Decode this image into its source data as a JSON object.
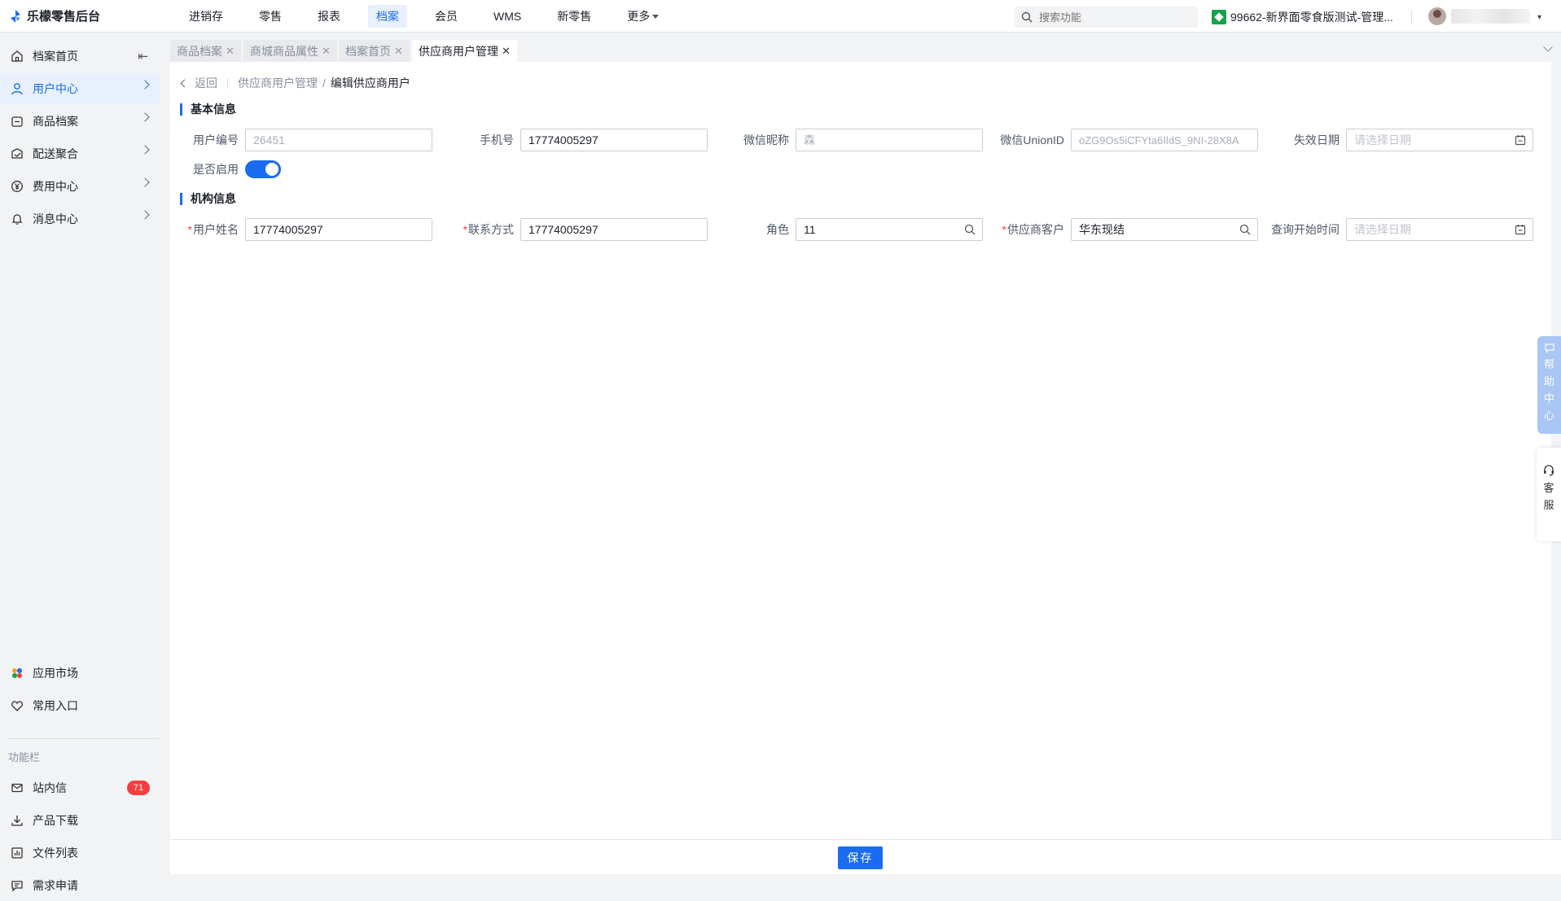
{
  "app": {
    "title": "乐檬零售后台"
  },
  "topnav": [
    {
      "label": "进销存",
      "active": false
    },
    {
      "label": "零售",
      "active": false
    },
    {
      "label": "报表",
      "active": false
    },
    {
      "label": "档案",
      "active": true
    },
    {
      "label": "会员",
      "active": false
    },
    {
      "label": "WMS",
      "active": false
    },
    {
      "label": "新零售",
      "active": false
    },
    {
      "label": "更多",
      "active": false
    }
  ],
  "search": {
    "placeholder": "搜索功能"
  },
  "store": {
    "name": "99662-新界面零食版测试-管理..."
  },
  "sidebar": {
    "items": [
      {
        "label": "档案首页",
        "icon": "home-icon"
      },
      {
        "label": "用户中心",
        "icon": "user-icon",
        "active": true
      },
      {
        "label": "商品档案",
        "icon": "goods-icon"
      },
      {
        "label": "配送聚合",
        "icon": "delivery-icon"
      },
      {
        "label": "费用中心",
        "icon": "yen-icon"
      },
      {
        "label": "消息中心",
        "icon": "bell-icon"
      }
    ],
    "bottom_items": [
      {
        "label": "应用市场",
        "icon": "app-market-icon"
      },
      {
        "label": "常用入口",
        "icon": "heart-icon"
      }
    ],
    "section_label": "功能栏",
    "func_items": [
      {
        "label": "站内信",
        "icon": "mail-icon",
        "badge": "71"
      },
      {
        "label": "产品下载",
        "icon": "download-icon"
      },
      {
        "label": "文件列表",
        "icon": "file-list-icon"
      },
      {
        "label": "需求申请",
        "icon": "request-icon"
      }
    ]
  },
  "tabs": [
    {
      "label": "商品档案",
      "active": false
    },
    {
      "label": "商城商品属性",
      "active": false
    },
    {
      "label": "档案首页",
      "active": false
    },
    {
      "label": "供应商用户管理",
      "active": true
    }
  ],
  "breadcrumb": {
    "back": "返回",
    "parent": "供应商用户管理",
    "sep": "/",
    "current": "编辑供应商用户"
  },
  "basic": {
    "title": "基本信息",
    "user_no": {
      "label": "用户编号",
      "value": "26451"
    },
    "phone": {
      "label": "手机号",
      "value": "17774005297"
    },
    "wechat_nick": {
      "label": "微信昵称",
      "value": "森"
    },
    "union_id": {
      "label": "微信UnionID",
      "value": "oZG9Os5iCFYta6IldS_9NI-28X8A"
    },
    "expire": {
      "label": "失效日期",
      "placeholder": "请选择日期"
    },
    "enabled": {
      "label": "是否启用",
      "on": true
    }
  },
  "org": {
    "title": "机构信息",
    "user_name": {
      "label": "用户姓名",
      "value": "17774005297"
    },
    "contact": {
      "label": "联系方式",
      "value": "17774005297"
    },
    "role": {
      "label": "角色",
      "value": "11"
    },
    "supplier": {
      "label": "供应商客户",
      "value": "华东现结"
    },
    "query_start": {
      "label": "查询开始时间",
      "placeholder": "请选择日期"
    }
  },
  "footer": {
    "save": "保存"
  },
  "float": {
    "help": [
      "帮",
      "助",
      "中",
      "心"
    ],
    "service": [
      "客",
      "服"
    ]
  },
  "colors": {
    "primary": "#1a6cf0",
    "badge": "#f53f3f",
    "help_bg": "#a9c6f4"
  }
}
